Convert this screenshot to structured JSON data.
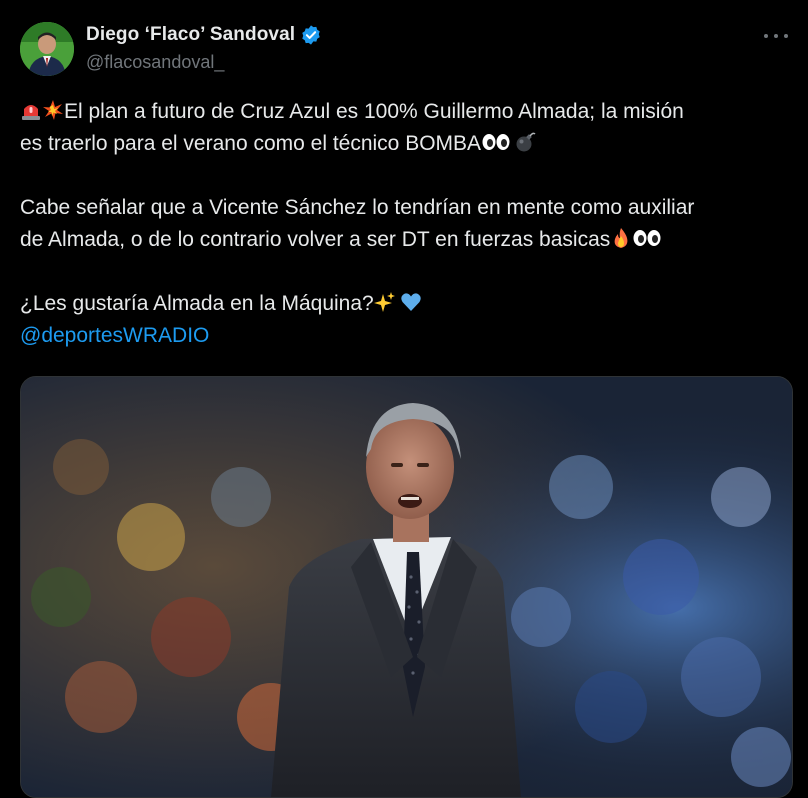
{
  "author": {
    "display_name": "Diego ‘Flaco’ Sandoval",
    "handle": "@flacosandoval_",
    "verified": true,
    "avatar_icon": "avatar-photo"
  },
  "tweet": {
    "line1": "El plan a futuro de Cruz Azul es 100% Guillermo Almada; la misión",
    "line2": "es traerlo para el verano como el técnico BOMBA",
    "para2_line1": "Cabe señalar que a Vicente Sánchez lo tendrían en mente como auxiliar",
    "para2_line2": "de Almada, o de lo contrario volver a ser DT en fuerzas basicas",
    "para3": "¿Les gustaría Almada en la Máquina?",
    "mention": "@deportesWRADIO"
  },
  "icons": {
    "siren": "siren-emoji",
    "collision": "collision-emoji",
    "eyes": "eyes-emoji",
    "bomb": "bomb-emoji",
    "fire": "fire-emoji",
    "sparkles": "sparkles-emoji",
    "blue_heart": "blue-heart-emoji",
    "more": "more-options-icon",
    "verified": "verified-badge-icon"
  },
  "colors": {
    "background": "#000000",
    "text": "#e7e9ea",
    "secondary": "#71767b",
    "accent": "#1d9bf0"
  }
}
